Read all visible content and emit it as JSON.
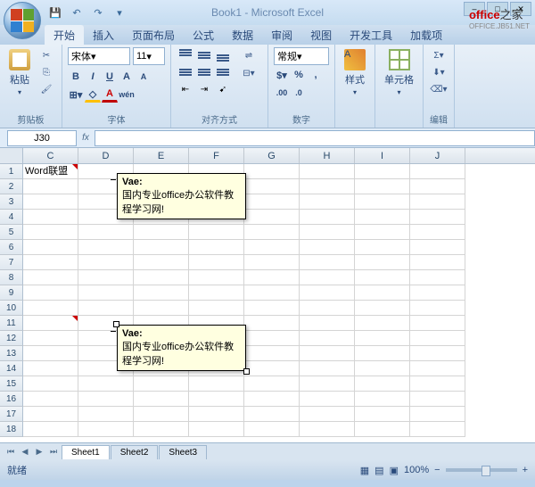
{
  "window": {
    "title": "Book1 - Microsoft Excel"
  },
  "watermark": {
    "brand_en": "office",
    "brand_cn": "之家",
    "url": "OFFICE.JB51.NET"
  },
  "qat": {
    "save": "💾",
    "undo": "↶",
    "redo": "↷"
  },
  "tabs": [
    "开始",
    "插入",
    "页面布局",
    "公式",
    "数据",
    "审阅",
    "视图",
    "开发工具",
    "加载项"
  ],
  "ribbon": {
    "clipboard": {
      "label": "剪贴板",
      "paste": "粘贴"
    },
    "font": {
      "label": "字体",
      "name": "宋体",
      "size": "11",
      "increase": "A",
      "decrease": "A"
    },
    "align": {
      "label": "对齐方式"
    },
    "number": {
      "label": "数字",
      "format": "常规",
      "percent": "%",
      "comma": ","
    },
    "styles": {
      "label": "样式",
      "btn": "样式"
    },
    "cells": {
      "label": "单元格",
      "btn": "单元格"
    },
    "editing": {
      "label": "编辑"
    }
  },
  "namebox": "J30",
  "fx": "fx",
  "columns": [
    "C",
    "D",
    "E",
    "F",
    "G",
    "H",
    "I",
    "J"
  ],
  "rows": [
    1,
    2,
    3,
    4,
    5,
    6,
    7,
    8,
    9,
    10,
    11,
    12,
    13,
    14,
    15,
    16,
    17,
    18
  ],
  "cell_c1": "Word联盟",
  "comments": [
    {
      "author": "Vae:",
      "text": "国内专业office办公软件教程学习网!"
    },
    {
      "author": "Vae:",
      "text": "国内专业office办公软件教程学习网!"
    }
  ],
  "sheets": [
    "Sheet1",
    "Sheet2",
    "Sheet3"
  ],
  "status": {
    "ready": "就绪",
    "zoom": "100%",
    "minus": "−",
    "plus": "+"
  }
}
